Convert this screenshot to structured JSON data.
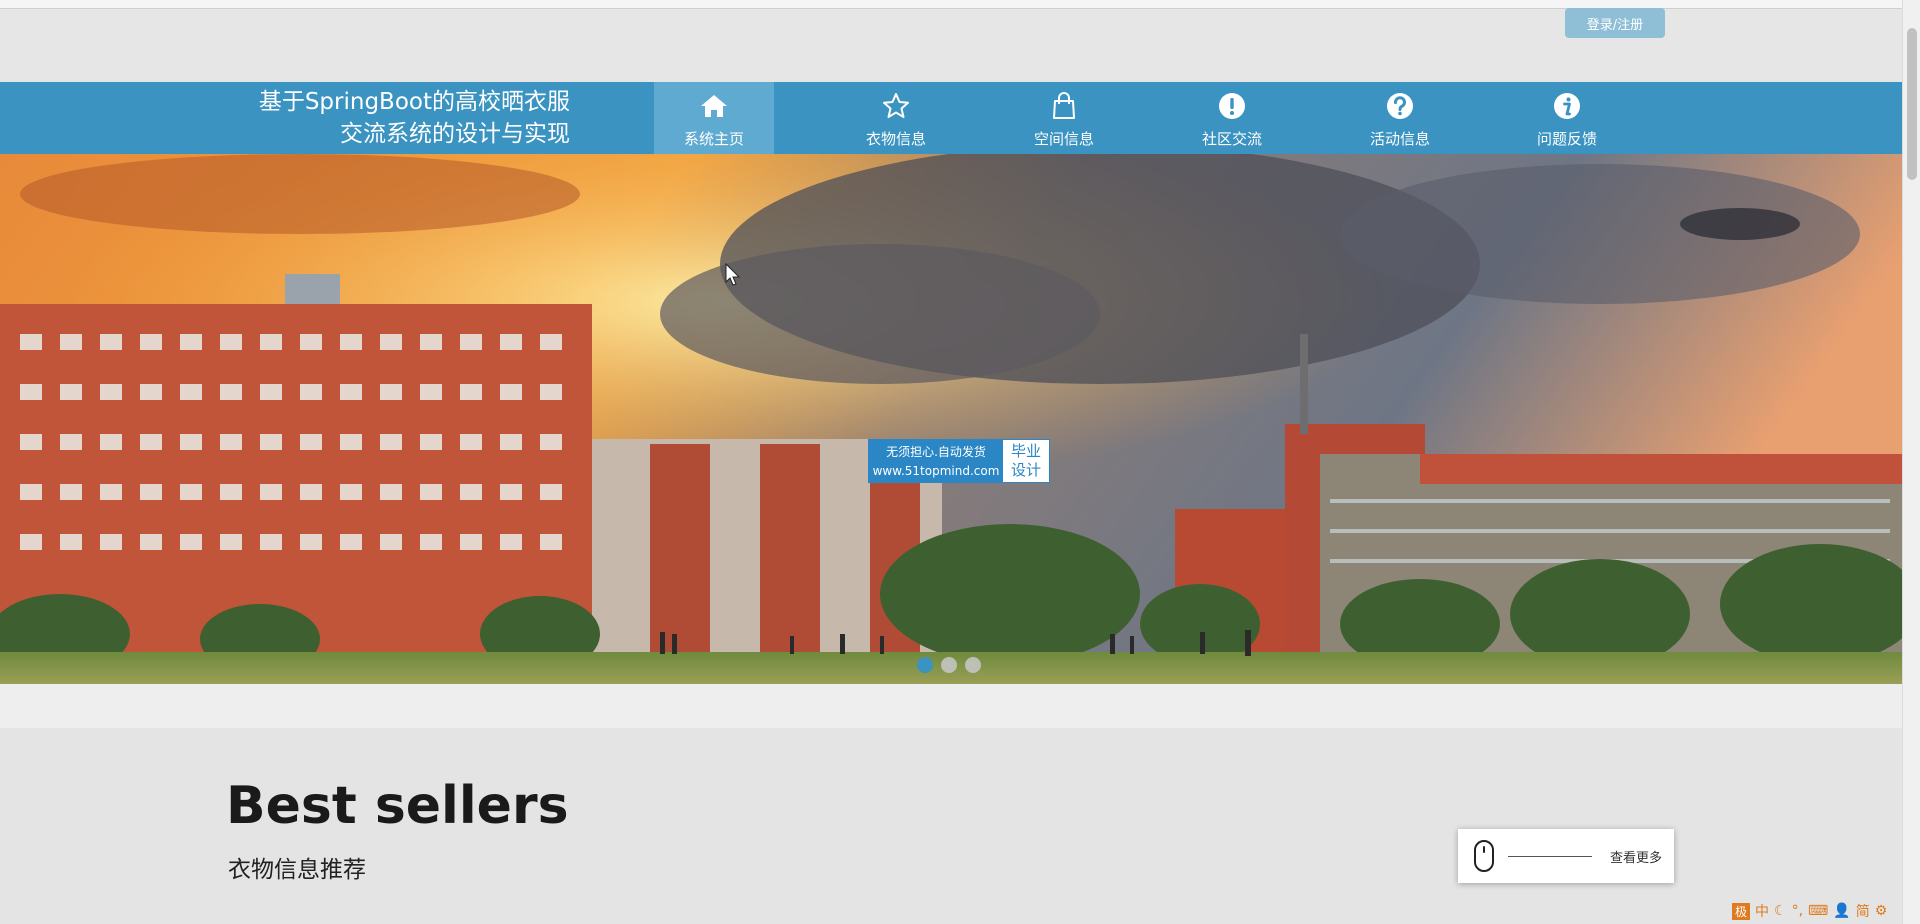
{
  "header": {
    "login_label": "登录/注册",
    "site_title_line1": "基于SpringBoot的高校晒衣服",
    "site_title_line2": "交流系统的设计与实现"
  },
  "nav": {
    "items": [
      {
        "label": "系统主页",
        "icon": "home-icon",
        "active": true
      },
      {
        "label": "衣物信息",
        "icon": "star-icon",
        "active": false
      },
      {
        "label": "空间信息",
        "icon": "shopping-bag-icon",
        "active": false
      },
      {
        "label": "社区交流",
        "icon": "exclamation-icon",
        "active": false
      },
      {
        "label": "活动信息",
        "icon": "question-icon",
        "active": false
      },
      {
        "label": "问题反馈",
        "icon": "info-icon",
        "active": false
      }
    ],
    "accent_color": "#3a93c0"
  },
  "hero": {
    "watermark": {
      "line1": "无须担心.自动发货",
      "line2": "www.51topmind.com",
      "right_line1": "毕业",
      "right_line2": "设计"
    },
    "carousel": {
      "slide_count": 3,
      "active_index": 0
    }
  },
  "section": {
    "title": "Best sellers",
    "subtitle": "衣物信息推荐",
    "more_label": "查看更多"
  },
  "ime": {
    "logo": "极",
    "mode": "中",
    "script": "简"
  }
}
